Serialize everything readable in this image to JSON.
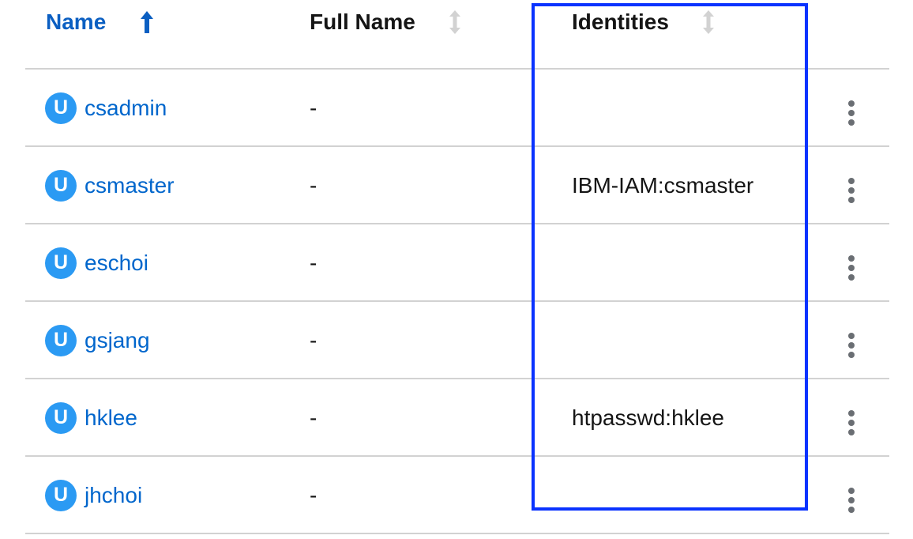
{
  "table": {
    "columns": {
      "name": "Name",
      "full_name": "Full Name",
      "identities": "Identities"
    },
    "sort": {
      "active_column": "Name",
      "direction": "ascending"
    },
    "rows": [
      {
        "badge": "U",
        "name": "csadmin",
        "full_name": "-",
        "identity": ""
      },
      {
        "badge": "U",
        "name": "csmaster",
        "full_name": "-",
        "identity": "IBM-IAM:csmaster"
      },
      {
        "badge": "U",
        "name": "eschoi",
        "full_name": "-",
        "identity": ""
      },
      {
        "badge": "U",
        "name": "gsjang",
        "full_name": "-",
        "identity": ""
      },
      {
        "badge": "U",
        "name": "hklee",
        "full_name": "-",
        "identity": "htpasswd:hklee"
      },
      {
        "badge": "U",
        "name": "jhchoi",
        "full_name": "-",
        "identity": ""
      }
    ]
  },
  "icons": {
    "sort_active": "arrow-up-icon",
    "sort_inactive": "sort-updown-icon",
    "row_actions": "kebab-menu-icon",
    "user_badge": "user-badge-icon"
  },
  "colors": {
    "link": "#0066cc",
    "active_sort_header": "#0b5fc2",
    "badge_bg": "#2b9af3",
    "highlight_border": "#0a33ff",
    "row_divider": "#d2d2d2"
  }
}
